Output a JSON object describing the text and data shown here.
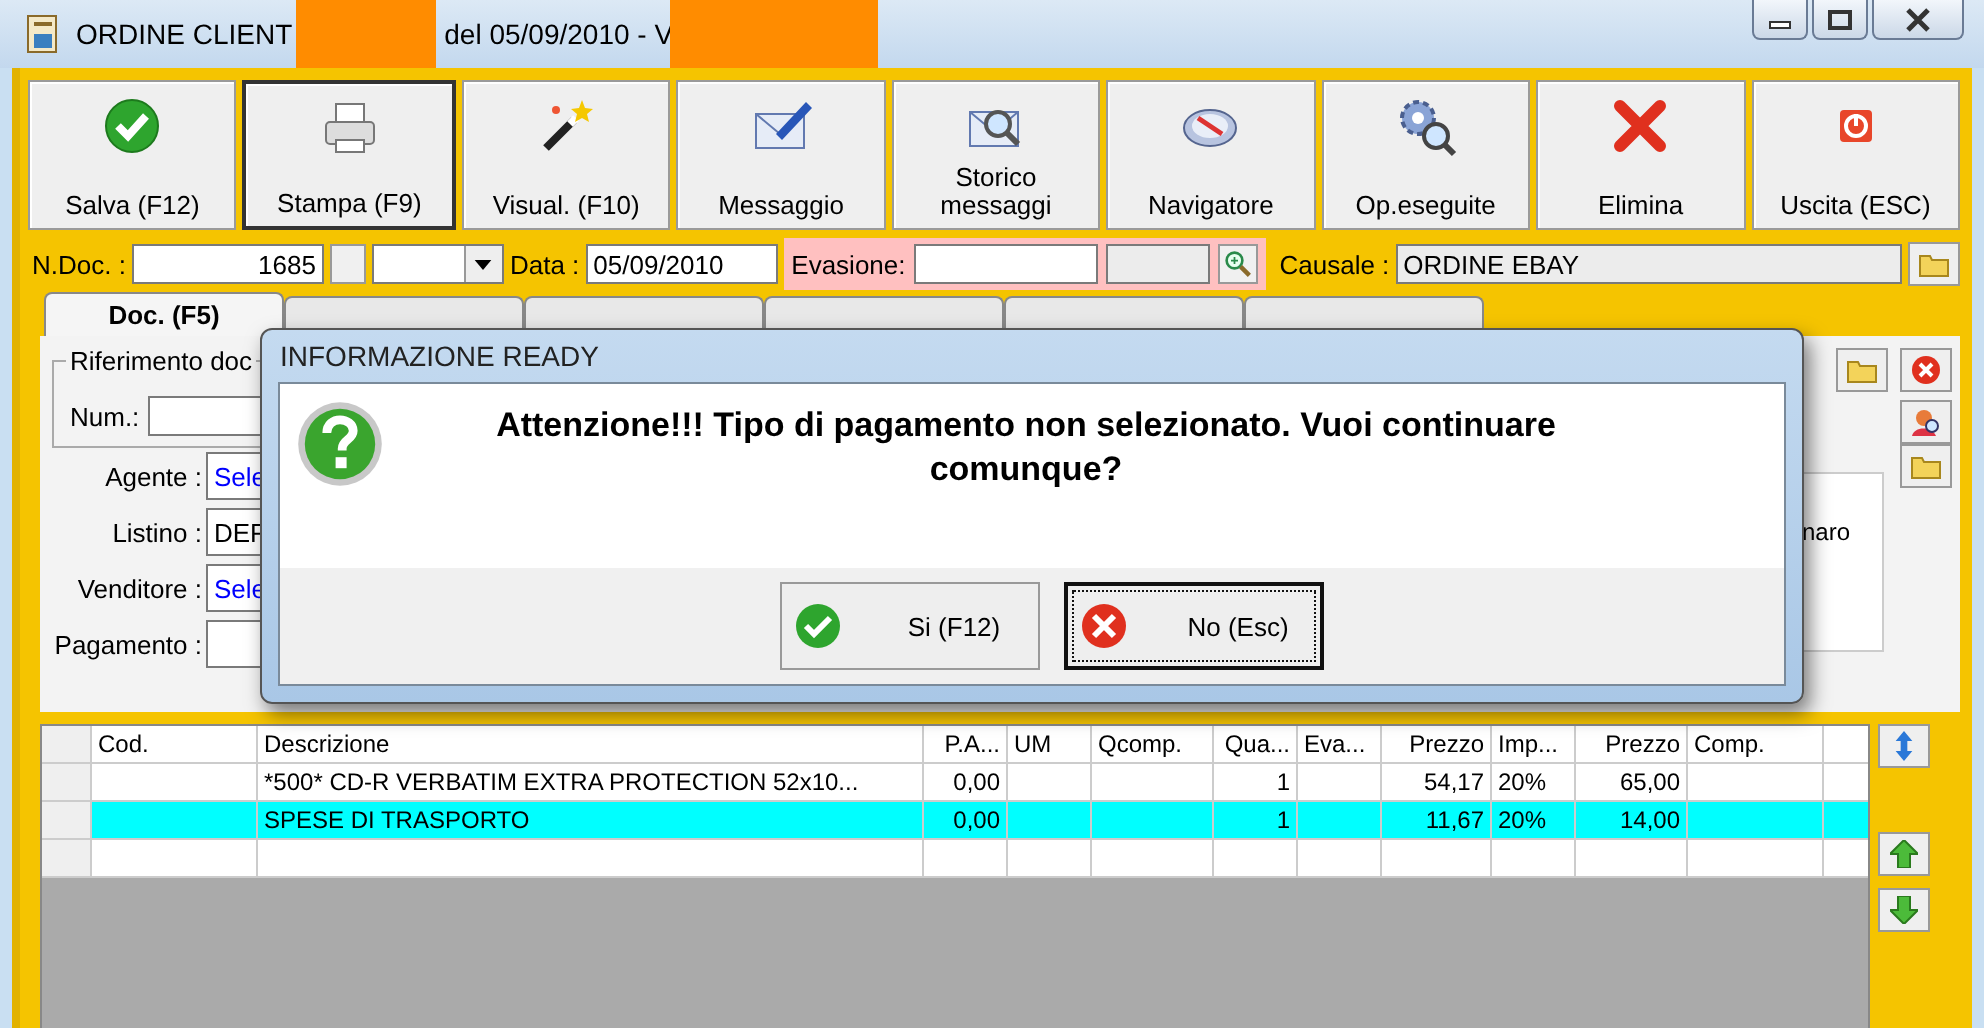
{
  "window": {
    "title_start": "ORDINE CLIENT",
    "title_end": "del 05/09/2010 - V"
  },
  "toolbar": [
    {
      "label": "Salva (F12)",
      "kind": "check",
      "selected": false
    },
    {
      "label": "Stampa (F9)",
      "kind": "printer",
      "selected": true
    },
    {
      "label": "Visual. (F10)",
      "kind": "wand",
      "selected": false
    },
    {
      "label": "Messaggio",
      "kind": "mail",
      "selected": false
    },
    {
      "label": "Storico messaggi",
      "kind": "mailsearch",
      "selected": false
    },
    {
      "label": "Navigatore",
      "kind": "compass",
      "selected": false
    },
    {
      "label": "Op.eseguite",
      "kind": "gears",
      "selected": false
    },
    {
      "label": "Elimina",
      "kind": "cross",
      "selected": false
    },
    {
      "label": "Uscita (ESC)",
      "kind": "power",
      "selected": false
    }
  ],
  "header": {
    "ndoc_label": "N.Doc. :",
    "ndoc_value": "1685",
    "data_label": "Data :",
    "data_value": "05/09/2010",
    "evasione_label": "Evasione:",
    "causale_label": "Causale :",
    "causale_value": "ORDINE EBAY"
  },
  "tabs": [
    {
      "label": "Doc. (F5)",
      "selected": true
    },
    {
      "selected": false
    },
    {
      "selected": false
    },
    {
      "selected": false
    },
    {
      "selected": false
    },
    {
      "selected": false
    }
  ],
  "panel": {
    "group_title": "Riferimento doc",
    "num_label": "Num.:",
    "rows": [
      {
        "label": "Agente :",
        "value": "Sele",
        "kind": "link"
      },
      {
        "label": "Listino :",
        "value": "DEF",
        "kind": "text"
      },
      {
        "label": "Venditore :",
        "value": "Sele",
        "kind": "link"
      },
      {
        "label": "Pagamento :",
        "kind": "text"
      }
    ],
    "side_text": "naro"
  },
  "grid": {
    "columns": [
      "Cod.",
      "Descrizione",
      "P.A...",
      "UM",
      "Qcomp.",
      "Qua...",
      "Eva...",
      "Prezzo",
      "Imp...",
      "Prezzo",
      "Comp."
    ],
    "rows": [
      {
        "selected": false,
        "cells": [
          "",
          "*500* CD-R VERBATIM EXTRA PROTECTION 52x10...",
          "0,00",
          "",
          "",
          "1",
          "",
          "54,17",
          "20%",
          "65,00",
          ""
        ]
      },
      {
        "selected": true,
        "cells": [
          "",
          "SPESE DI TRASPORTO",
          "0,00",
          "",
          "",
          "1",
          "",
          "11,67",
          "20%",
          "14,00",
          ""
        ]
      }
    ]
  },
  "dialog": {
    "title": "INFORMAZIONE READY",
    "message": "Attenzione!!! Tipo di pagamento non selezionato. Vuoi continuare comunque?",
    "buttons": [
      {
        "label": "Si (F12)",
        "kind": "confirm",
        "focused": false
      },
      {
        "label": "No (Esc)",
        "kind": "cancel",
        "focused": true
      }
    ]
  }
}
